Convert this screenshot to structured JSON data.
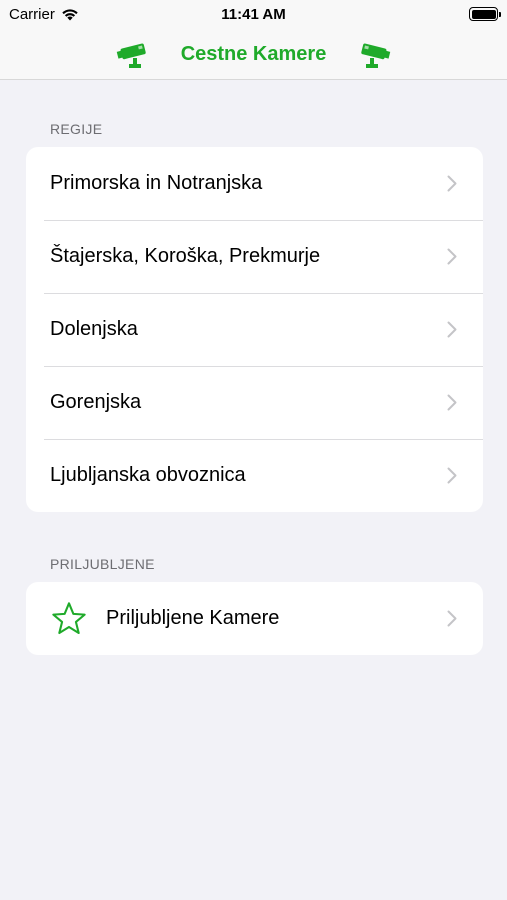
{
  "status": {
    "carrier": "Carrier",
    "time": "11:41 AM"
  },
  "nav": {
    "title": "Cestne Kamere"
  },
  "sections": {
    "regions_header": "REGIJE",
    "regions": [
      {
        "label": "Primorska in Notranjska"
      },
      {
        "label": "Štajerska, Koroška, Prekmurje"
      },
      {
        "label": "Dolenjska"
      },
      {
        "label": "Gorenjska"
      },
      {
        "label": "Ljubljanska obvoznica"
      }
    ],
    "favorites_header": "PRILJUBLJENE",
    "favorites": {
      "label": "Priljubljene Kamere"
    }
  },
  "icons": {
    "wifi": "wifi-icon",
    "battery": "battery-icon",
    "camera": "security-camera-icon",
    "chevron": "chevron-right-icon",
    "star": "star-outline-icon"
  },
  "colors": {
    "accent": "#1faa2a",
    "background": "#f2f2f7"
  }
}
